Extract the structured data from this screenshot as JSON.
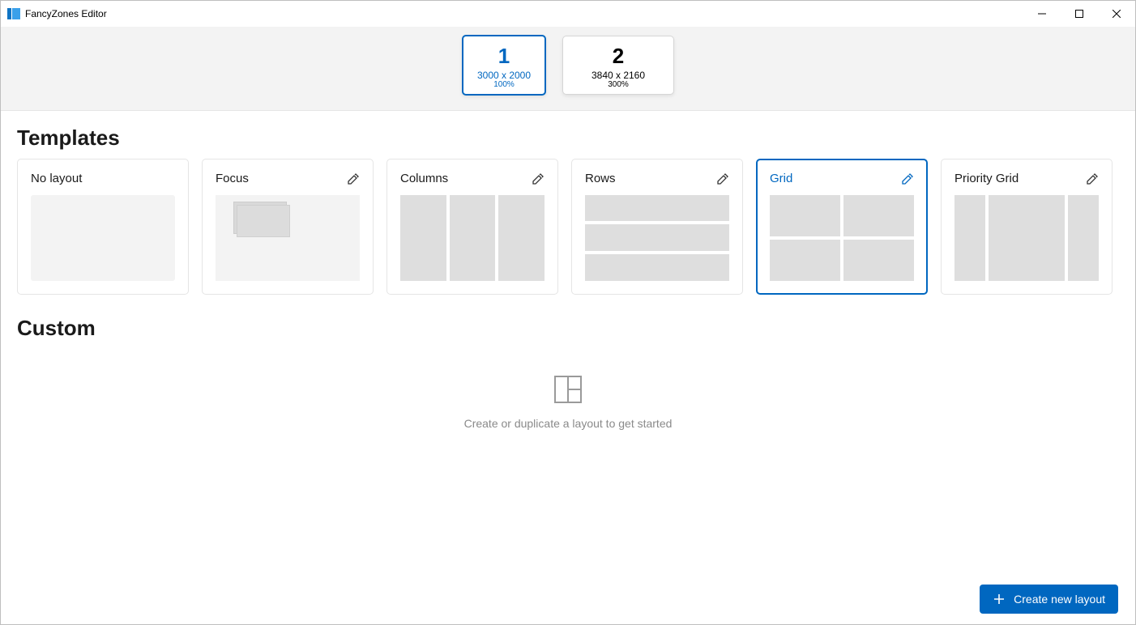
{
  "window": {
    "title": "FancyZones Editor"
  },
  "monitors": [
    {
      "num": "1",
      "res": "3000 x 2000",
      "scale": "100%",
      "selected": true
    },
    {
      "num": "2",
      "res": "3840 x 2160",
      "scale": "300%",
      "selected": false
    }
  ],
  "sections": {
    "templates": "Templates",
    "custom": "Custom"
  },
  "templates": [
    {
      "key": "none",
      "label": "No layout",
      "editable": false,
      "selected": false
    },
    {
      "key": "focus",
      "label": "Focus",
      "editable": true,
      "selected": false
    },
    {
      "key": "columns",
      "label": "Columns",
      "editable": true,
      "selected": false
    },
    {
      "key": "rows",
      "label": "Rows",
      "editable": true,
      "selected": false
    },
    {
      "key": "grid",
      "label": "Grid",
      "editable": true,
      "selected": true
    },
    {
      "key": "priority",
      "label": "Priority Grid",
      "editable": true,
      "selected": false
    }
  ],
  "custom_empty_message": "Create or duplicate a layout to get started",
  "create_button": "Create new layout"
}
